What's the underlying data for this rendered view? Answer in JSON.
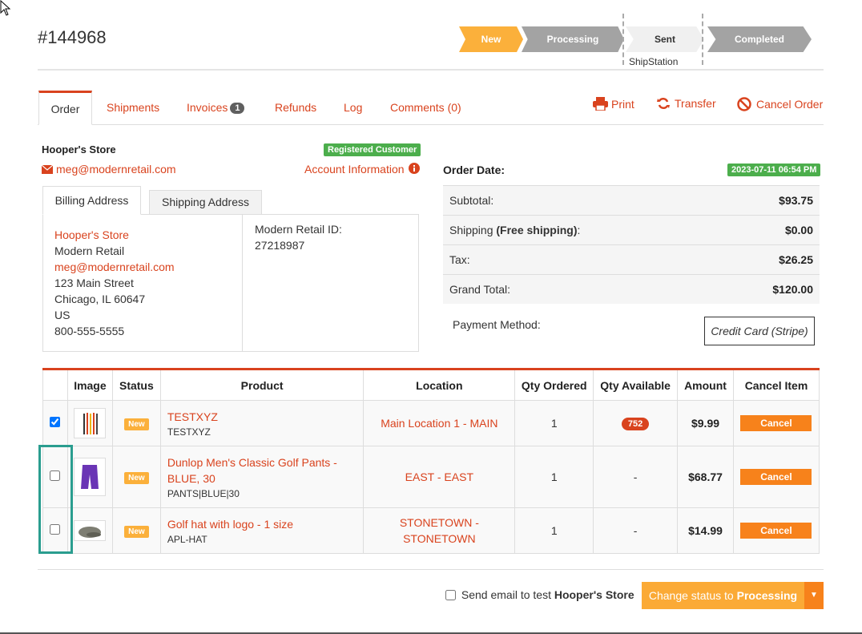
{
  "order": {
    "number": "#144968"
  },
  "progress": {
    "steps": [
      "New",
      "Processing",
      "Sent",
      "Completed"
    ],
    "sub_label": "ShipStation",
    "colors": {
      "active": "#fbb03b",
      "inactive": "#a3a3a3"
    }
  },
  "tabs": {
    "order": "Order",
    "shipments": "Shipments",
    "invoices": "Invoices",
    "invoices_count": "1",
    "refunds": "Refunds",
    "log": "Log",
    "comments": "Comments (0)"
  },
  "actions": {
    "print": "Print",
    "transfer": "Transfer",
    "cancel_order": "Cancel Order"
  },
  "customer": {
    "store": "Hooper's Store",
    "badge": "Registered Customer",
    "email": "meg@modernretail.com",
    "account_info": "Account Information"
  },
  "address": {
    "tab_billing": "Billing Address",
    "tab_shipping": "Shipping Address",
    "lines": [
      "Hooper's Store",
      "Modern Retail",
      "meg@modernretail.com",
      "123 Main Street",
      "Chicago, IL 60647",
      "US",
      "800-555-5555"
    ],
    "id_label": "Modern Retail ID:",
    "id_value": "27218987"
  },
  "totals": {
    "order_date_label": "Order Date:",
    "order_date": "2023-07-11 06:54 PM",
    "subtotal_label": "Subtotal:",
    "subtotal": "$93.75",
    "shipping_label": "Shipping",
    "shipping_note": "(Free shipping)",
    "shipping_colon": ":",
    "shipping": "$0.00",
    "tax_label": "Tax:",
    "tax": "$26.25",
    "grand_label": "Grand Total:",
    "grand": "$120.00",
    "payment_label": "Payment Method:",
    "payment_method": "Credit Card (Stripe)"
  },
  "table": {
    "headers": [
      "",
      "Image",
      "Status",
      "Product",
      "Location",
      "Qty Ordered",
      "Qty Available",
      "Amount",
      "Cancel Item"
    ],
    "rows": [
      {
        "checked": true,
        "status": "New",
        "product": "TESTXYZ",
        "sku": "TESTXYZ",
        "location": "Main Location 1 - MAIN",
        "qty_ordered": "1",
        "qty_available": "752",
        "amount": "$9.99",
        "cancel": "Cancel"
      },
      {
        "checked": false,
        "status": "New",
        "product": "Dunlop Men's Classic Golf Pants - BLUE, 30",
        "sku": "PANTS|BLUE|30",
        "location": "EAST - EAST",
        "qty_ordered": "1",
        "qty_available": "-",
        "amount": "$68.77",
        "cancel": "Cancel"
      },
      {
        "checked": false,
        "status": "New",
        "product": "Golf hat with logo - 1 size",
        "sku": "APL-HAT",
        "location": "STONETOWN - STONETOWN",
        "qty_ordered": "1",
        "qty_available": "-",
        "amount": "$14.99",
        "cancel": "Cancel"
      }
    ]
  },
  "footer": {
    "send_email_prefix": "Send email to test",
    "send_email_store": "Hooper's Store",
    "status_prefix": "Change status to",
    "status_target": "Processing"
  }
}
